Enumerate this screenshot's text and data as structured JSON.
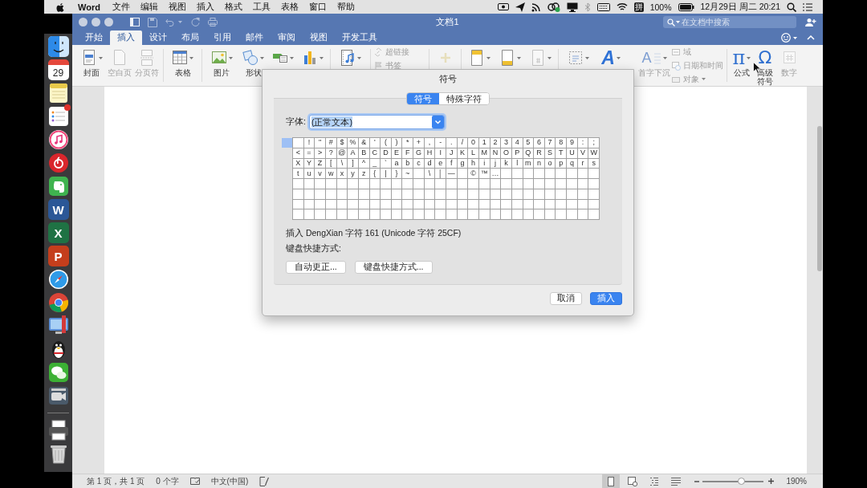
{
  "menu_bar": {
    "app_name": "Word",
    "menus": [
      "文件",
      "编辑",
      "视图",
      "插入",
      "格式",
      "工具",
      "表格",
      "窗口",
      "帮助"
    ],
    "input_method": "拼",
    "battery": "100%",
    "clock": "12月29日 周二 20:21"
  },
  "dock": {
    "apps": [
      {
        "kind": "face",
        "badge": false
      },
      {
        "kind": "calendar",
        "text": "29",
        "badge": false
      },
      {
        "kind": "notepad",
        "badge": false
      },
      {
        "kind": "checklist",
        "badge": true
      },
      {
        "kind": "note",
        "badge": false
      },
      {
        "kind": "disc",
        "badge": false
      },
      {
        "kind": "elephant",
        "badge": false
      },
      {
        "kind": "tile",
        "text": "W",
        "color": "#2b5797",
        "badge": false
      },
      {
        "kind": "tile",
        "text": "X",
        "color": "#1f7244",
        "badge": false
      },
      {
        "kind": "tile",
        "text": "P",
        "color": "#c43e1c",
        "badge": false
      },
      {
        "kind": "compass",
        "badge": false
      },
      {
        "kind": "wheel",
        "badge": false
      },
      {
        "kind": "monitor",
        "badge": false
      },
      {
        "kind": "penguin",
        "badge": false
      },
      {
        "kind": "bubbles",
        "badge": false
      },
      {
        "kind": "camera",
        "badge": false
      }
    ],
    "utilities": [
      {
        "kind": "printer"
      },
      {
        "kind": "trash"
      }
    ]
  },
  "window": {
    "title": "文档1",
    "search": {
      "placeholder": "在文档中搜索"
    }
  },
  "tabs": [
    {
      "label": "开始",
      "selected": false
    },
    {
      "label": "插入",
      "selected": true
    },
    {
      "label": "设计",
      "selected": false
    },
    {
      "label": "布局",
      "selected": false
    },
    {
      "label": "引用",
      "selected": false
    },
    {
      "label": "邮件",
      "selected": false
    },
    {
      "label": "审阅",
      "selected": false
    },
    {
      "label": "视图",
      "selected": false
    },
    {
      "label": "开发工具",
      "selected": false
    }
  ],
  "ribbon": {
    "groups": [
      {
        "items": [
          {
            "kind": "cover",
            "label": "封面",
            "dropdown": true,
            "disabled": false
          },
          {
            "kind": "blank",
            "label": "空白页",
            "dropdown": false,
            "disabled": true
          },
          {
            "kind": "pagebreak",
            "label": "分页符",
            "dropdown": false,
            "disabled": true
          }
        ]
      },
      {
        "items": [
          {
            "kind": "table",
            "label": "表格",
            "dropdown": true,
            "disabled": false
          }
        ]
      },
      {
        "items": [
          {
            "kind": "pictures",
            "label": "图片",
            "dropdown": true,
            "disabled": false
          },
          {
            "kind": "shapes",
            "label": "形状",
            "dropdown": true,
            "disabled": false
          },
          {
            "kind": "diagram",
            "dropdown": true,
            "disabled": false
          },
          {
            "kind": "chart",
            "dropdown": true,
            "disabled": false
          }
        ]
      },
      {
        "items": [
          {
            "kind": "media",
            "dropdown": true,
            "disabled": false
          }
        ]
      },
      {
        "items": [
          {
            "kind": "stack",
            "entries": [
              {
                "kind": "hyperlink",
                "label": "超链接",
                "dropdown": false,
                "disabled": true
              },
              {
                "kind": "bookmark",
                "label": "书签",
                "dropdown": false,
                "disabled": true
              }
            ]
          }
        ]
      },
      {
        "items": [
          {
            "kind": "addins",
            "dropdown": false,
            "disabled": true
          }
        ]
      },
      {
        "items": [
          {
            "kind": "header",
            "dropdown": true,
            "disabled": false
          },
          {
            "kind": "footer",
            "dropdown": true,
            "disabled": false
          },
          {
            "kind": "pagenumber",
            "dropdown": true,
            "disabled": true
          }
        ]
      },
      {
        "items": [
          {
            "kind": "textbox",
            "dropdown": true,
            "disabled": false
          },
          {
            "kind": "wordart",
            "glyph": "A",
            "dropdown": true,
            "disabled": false
          },
          {
            "kind": "dropcap",
            "glyph": "A",
            "label": "首字下沉",
            "dropdown": true,
            "disabled": true
          },
          {
            "kind": "stack",
            "entries": [
              {
                "kind": "field",
                "label": "域",
                "dropdown": false,
                "disabled": true
              },
              {
                "kind": "datetime",
                "label": "日期和时间",
                "dropdown": false,
                "disabled": true
              },
              {
                "kind": "object",
                "label": "对象",
                "dropdown": true,
                "disabled": true
              }
            ]
          }
        ]
      },
      {
        "items": [
          {
            "kind": "equation",
            "glyph": "π",
            "label": "公式",
            "dropdown": true,
            "disabled": false
          },
          {
            "kind": "symbol",
            "glyph": "Ω",
            "label": "高级符号",
            "dropdown": false,
            "disabled": false
          },
          {
            "kind": "number",
            "label": "数字",
            "dropdown": false,
            "disabled": true
          }
        ]
      }
    ]
  },
  "dialog": {
    "title": "符号",
    "tabs": [
      {
        "label": "符号",
        "selected": true
      },
      {
        "label": "特殊字符",
        "selected": false
      }
    ],
    "font_label": "字体:",
    "font_value": "(正常文本)",
    "grid": {
      "rows": [
        [
          {
            "kind": "blank"
          },
          {
            "kind": "glyph",
            "char": "!"
          },
          {
            "kind": "glyph",
            "char": "\""
          },
          {
            "kind": "glyph",
            "char": "#"
          },
          {
            "kind": "glyph",
            "char": "$"
          },
          {
            "kind": "glyph",
            "char": "%"
          },
          {
            "kind": "glyph",
            "char": "&"
          },
          {
            "kind": "glyph",
            "char": "'"
          },
          {
            "kind": "glyph",
            "char": "("
          },
          {
            "kind": "glyph",
            "char": ")"
          },
          {
            "kind": "glyph",
            "char": "*"
          },
          {
            "kind": "glyph",
            "char": "+"
          },
          {
            "kind": "glyph",
            "char": ","
          },
          {
            "kind": "glyph",
            "char": "-"
          },
          {
            "kind": "glyph",
            "char": "."
          },
          {
            "kind": "glyph",
            "char": "/"
          },
          {
            "kind": "glyph",
            "char": "0"
          },
          {
            "kind": "glyph",
            "char": "1"
          },
          {
            "kind": "glyph",
            "char": "2"
          },
          {
            "kind": "glyph",
            "char": "3"
          },
          {
            "kind": "glyph",
            "char": "4"
          },
          {
            "kind": "glyph",
            "char": "5"
          },
          {
            "kind": "glyph",
            "char": "6"
          },
          {
            "kind": "glyph",
            "char": "7"
          },
          {
            "kind": "glyph",
            "char": "8"
          },
          {
            "kind": "glyph",
            "char": "9"
          },
          {
            "kind": "glyph",
            "char": ":"
          },
          {
            "kind": "glyph",
            "char": ";"
          }
        ],
        [
          {
            "kind": "glyph",
            "char": "<"
          },
          {
            "kind": "glyph",
            "char": "="
          },
          {
            "kind": "glyph",
            "char": ">"
          },
          {
            "kind": "glyph",
            "char": "?"
          },
          {
            "kind": "glyph",
            "char": "@"
          },
          {
            "kind": "glyph",
            "char": "A"
          },
          {
            "kind": "glyph",
            "char": "B"
          },
          {
            "kind": "glyph",
            "char": "C"
          },
          {
            "kind": "glyph",
            "char": "D"
          },
          {
            "kind": "glyph",
            "char": "E"
          },
          {
            "kind": "glyph",
            "char": "F"
          },
          {
            "kind": "glyph",
            "char": "G"
          },
          {
            "kind": "glyph",
            "char": "H"
          },
          {
            "kind": "glyph",
            "char": "I"
          },
          {
            "kind": "glyph",
            "char": "J"
          },
          {
            "kind": "glyph",
            "char": "K"
          },
          {
            "kind": "glyph",
            "char": "L"
          },
          {
            "kind": "glyph",
            "char": "M"
          },
          {
            "kind": "glyph",
            "char": "N"
          },
          {
            "kind": "glyph",
            "char": "O"
          },
          {
            "kind": "glyph",
            "char": "P"
          },
          {
            "kind": "glyph",
            "char": "Q"
          },
          {
            "kind": "glyph",
            "char": "R"
          },
          {
            "kind": "glyph",
            "char": "S"
          },
          {
            "kind": "glyph",
            "char": "T"
          },
          {
            "kind": "glyph",
            "char": "U"
          },
          {
            "kind": "glyph",
            "char": "V"
          },
          {
            "kind": "glyph",
            "char": "W"
          }
        ],
        [
          {
            "kind": "glyph",
            "char": "X"
          },
          {
            "kind": "glyph",
            "char": "Y"
          },
          {
            "kind": "glyph",
            "char": "Z"
          },
          {
            "kind": "glyph",
            "char": "["
          },
          {
            "kind": "glyph",
            "char": "\\"
          },
          {
            "kind": "glyph",
            "char": "]"
          },
          {
            "kind": "glyph",
            "char": "^"
          },
          {
            "kind": "glyph",
            "char": "_"
          },
          {
            "kind": "glyph",
            "char": "`"
          },
          {
            "kind": "glyph",
            "char": "a"
          },
          {
            "kind": "glyph",
            "char": "b"
          },
          {
            "kind": "glyph",
            "char": "c"
          },
          {
            "kind": "glyph",
            "char": "d"
          },
          {
            "kind": "glyph",
            "char": "e"
          },
          {
            "kind": "glyph",
            "char": "f"
          },
          {
            "kind": "glyph",
            "char": "g"
          },
          {
            "kind": "glyph",
            "char": "h"
          },
          {
            "kind": "glyph",
            "char": "i"
          },
          {
            "kind": "glyph",
            "char": "j"
          },
          {
            "kind": "glyph",
            "char": "k"
          },
          {
            "kind": "glyph",
            "char": "l"
          },
          {
            "kind": "glyph",
            "char": "m"
          },
          {
            "kind": "glyph",
            "char": "n"
          },
          {
            "kind": "glyph",
            "char": "o"
          },
          {
            "kind": "glyph",
            "char": "p"
          },
          {
            "kind": "glyph",
            "char": "q"
          },
          {
            "kind": "glyph",
            "char": "r"
          },
          {
            "kind": "glyph",
            "char": "s"
          }
        ],
        [
          {
            "kind": "glyph",
            "char": "t"
          },
          {
            "kind": "glyph",
            "char": "u"
          },
          {
            "kind": "glyph",
            "char": "v"
          },
          {
            "kind": "glyph",
            "char": "w"
          },
          {
            "kind": "glyph",
            "char": "x"
          },
          {
            "kind": "glyph",
            "char": "y"
          },
          {
            "kind": "glyph",
            "char": "z"
          },
          {
            "kind": "glyph",
            "char": "{"
          },
          {
            "kind": "glyph",
            "char": "|"
          },
          {
            "kind": "glyph",
            "char": "}"
          },
          {
            "kind": "glyph",
            "char": "~"
          },
          {
            "kind": "blank"
          },
          {
            "kind": "glyph",
            "char": "\\"
          },
          {
            "kind": "glyph",
            "char": "│"
          },
          {
            "kind": "glyph",
            "char": "—"
          },
          {
            "kind": "blank"
          },
          {
            "kind": "glyph",
            "char": "©"
          },
          {
            "kind": "glyph",
            "char": "™"
          },
          {
            "kind": "glyph",
            "char": "…"
          }
        ]
      ]
    },
    "info": "插入 DengXian 字符 161 (Unicode 字符 25CF)",
    "shortcut_label": "键盘快捷方式:",
    "buttons": [
      "自动更正...",
      "键盘快捷方式..."
    ],
    "actions": [
      {
        "label": "取消",
        "default": false
      },
      {
        "label": "插入",
        "default": true
      }
    ]
  },
  "status_bar": {
    "page": "第 1 页，共 1 页",
    "words": "0 个字",
    "language": "中文(中国)",
    "views": [
      {
        "kind": "print",
        "selected": true
      },
      {
        "kind": "web",
        "selected": false
      },
      {
        "kind": "outline",
        "selected": false
      },
      {
        "kind": "draft",
        "selected": false
      }
    ],
    "zoom": {
      "level": 0.63,
      "percent": "190%"
    }
  }
}
